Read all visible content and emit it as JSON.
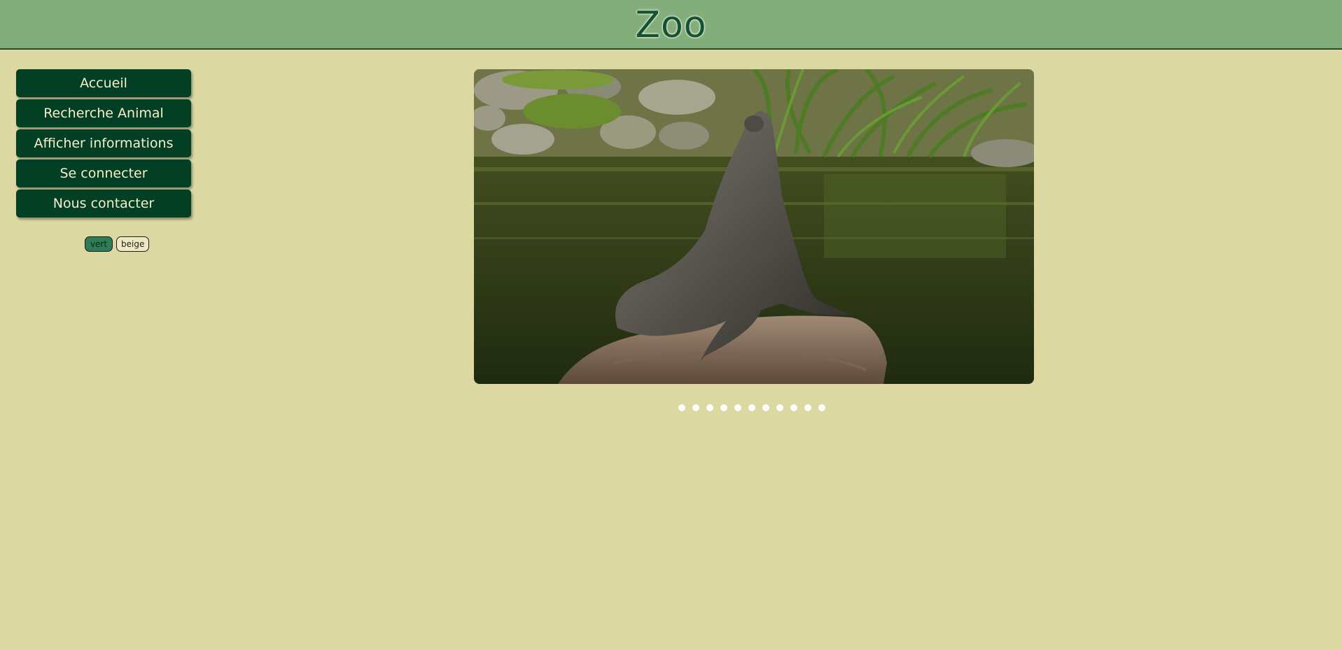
{
  "header": {
    "title": "Zoo"
  },
  "nav": {
    "items": [
      {
        "label": "Accueil"
      },
      {
        "label": "Recherche Animal"
      },
      {
        "label": "Afficher informations"
      },
      {
        "label": "Se connecter"
      },
      {
        "label": "Nous contacter"
      }
    ]
  },
  "theme": {
    "vert_label": "vert",
    "beige_label": "beige"
  },
  "slider": {
    "current_image_alt": "seal-on-rock",
    "slide_count": 11,
    "active_index": 0
  },
  "colors": {
    "background": "#dcd8a2",
    "header": "#84ad7c",
    "nav_button": "#023f25",
    "nav_text": "#f6efc8",
    "title": "#145234"
  }
}
